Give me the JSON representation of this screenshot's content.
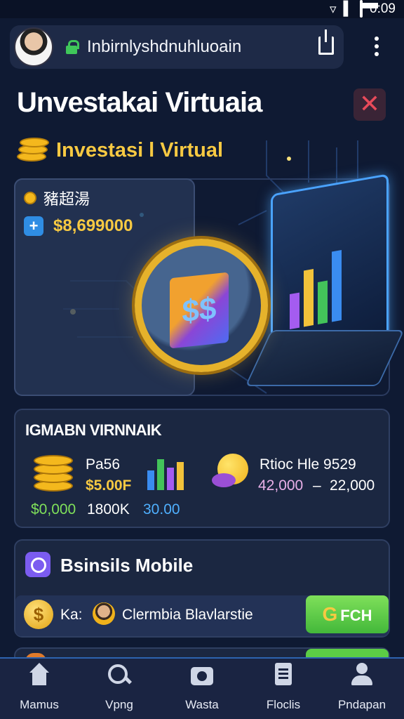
{
  "status_bar": {
    "time": "0:09"
  },
  "browser": {
    "url": "Inbirnlyshdnuhluoain"
  },
  "page": {
    "title": "Unvestakai Virtuaia",
    "subtitle": "Investasi l Virtual"
  },
  "hero": {
    "label": "豬超湯",
    "amount": "$8,699000",
    "box_symbol": "$$"
  },
  "stats": {
    "title": "IGMABN VIRNNAIK",
    "left_label": "Pa56",
    "left_value": "$5.00F",
    "left_bottom_1": "$0,000",
    "left_bottom_2": "1800K",
    "left_bottom_3": "30.00",
    "right_label": "Rtioc Hle 9529",
    "right_value_1": "42,000",
    "right_separator": "–",
    "right_value_2": "22,000"
  },
  "business": {
    "title": "Bsinsils Mobile",
    "row_prefix": "Ka:",
    "row_name": "Clermbia Blavlarstie",
    "button_label": "FCH",
    "button_icon_glyph": "G"
  },
  "nav": {
    "items": [
      {
        "label": "Mamus",
        "icon": "home-icon"
      },
      {
        "label": "Vpng",
        "icon": "search-icon"
      },
      {
        "label": "Wasta",
        "icon": "camera-icon"
      },
      {
        "label": "Floclis",
        "icon": "document-icon"
      },
      {
        "label": "Pndapan",
        "icon": "person-icon"
      }
    ]
  },
  "colors": {
    "background": "#0f1a33",
    "accent_gold": "#f7c942",
    "accent_green": "#43b83a",
    "accent_blue": "#2f8de4",
    "close_red": "#e84a5a"
  }
}
